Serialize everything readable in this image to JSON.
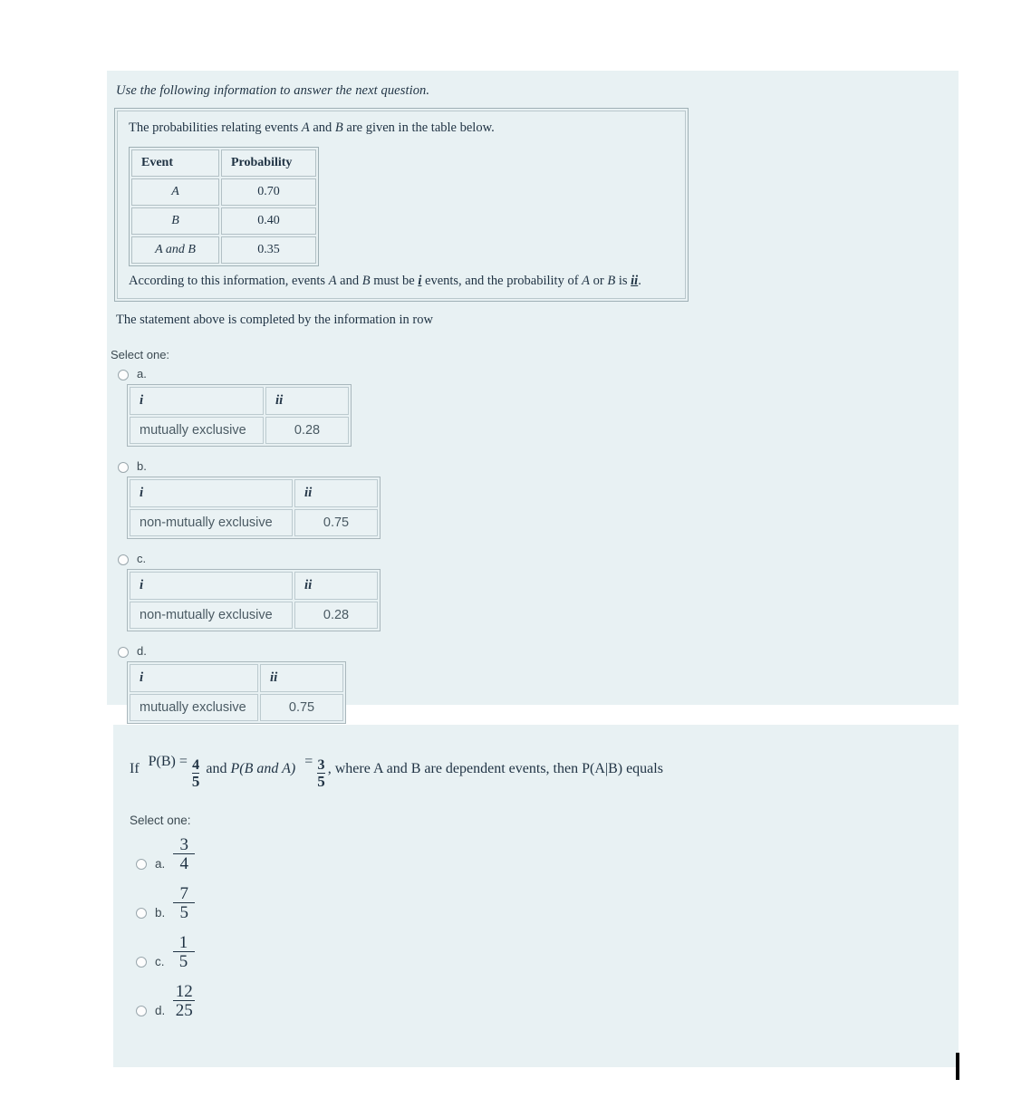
{
  "question1": {
    "lead": "Use the following information to answer the next question.",
    "intro_prefix": "The probabilities relating events ",
    "intro_a": "A",
    "intro_mid": " and ",
    "intro_b": "B",
    "intro_suffix": " are given in the table below.",
    "table": {
      "headers": [
        "Event",
        "Probability"
      ],
      "rows": [
        {
          "event": "A",
          "probability": "0.70"
        },
        {
          "event": "B",
          "probability": "0.40"
        },
        {
          "event": "A and B",
          "probability": "0.35"
        }
      ]
    },
    "conclusion": {
      "part1": "According to this information, events ",
      "ev_a": "A",
      "part2": " and ",
      "ev_b": "B",
      "part3": " must be ",
      "blank1": "i",
      "part4": " events, and the probability of ",
      "ev_a2": "A",
      "part5": " or ",
      "ev_b2": "B",
      "part6": " is ",
      "blank2": "ii",
      "part7": "."
    },
    "prompt": "The statement above is completed by the information in row",
    "select_label": "Select one:",
    "options": [
      {
        "letter": "a.",
        "headers": [
          "i",
          "ii"
        ],
        "cells": [
          "mutually exclusive",
          "0.28"
        ]
      },
      {
        "letter": "b.",
        "headers": [
          "i",
          "ii"
        ],
        "cells": [
          "non-mutually exclusive",
          "0.75"
        ]
      },
      {
        "letter": "c.",
        "headers": [
          "i",
          "ii"
        ],
        "cells": [
          "non-mutually exclusive",
          "0.28"
        ]
      },
      {
        "letter": "d.",
        "headers": [
          "i",
          "ii"
        ],
        "cells": [
          "mutually exclusive",
          "0.75"
        ]
      }
    ]
  },
  "question2": {
    "stem": {
      "if": "If",
      "pb_label": "P(B) =",
      "pb_num": "4",
      "pb_den": "5",
      "and": "and",
      "pba_label": "P(B and A)",
      "eq": "=",
      "pba_num": "3",
      "pba_den": "5",
      "tail": ", where A and B are dependent events, then P(A|B) equals"
    },
    "select_label": "Select one:",
    "options": [
      {
        "letter": "a.",
        "num": "3",
        "den": "4"
      },
      {
        "letter": "b.",
        "num": "7",
        "den": "5"
      },
      {
        "letter": "c.",
        "num": "1",
        "den": "5"
      },
      {
        "letter": "d.",
        "num": "12",
        "den": "25"
      }
    ]
  }
}
